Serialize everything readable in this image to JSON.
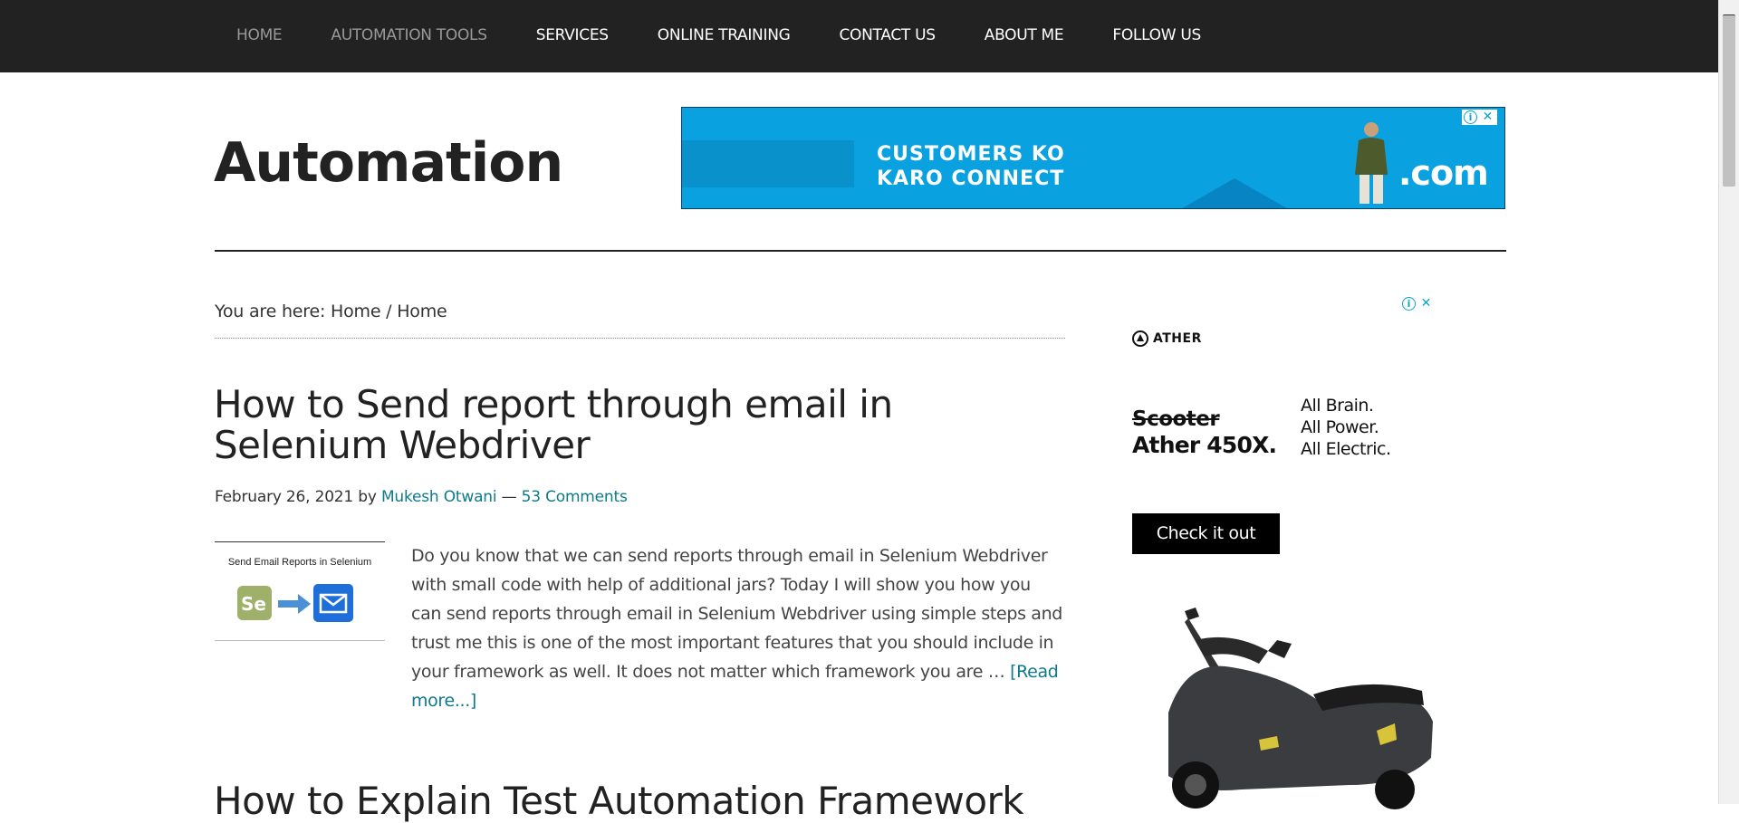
{
  "nav": {
    "items": [
      {
        "label": "HOME"
      },
      {
        "label": "AUTOMATION TOOLS"
      },
      {
        "label": "SERVICES"
      },
      {
        "label": "ONLINE TRAINING"
      },
      {
        "label": "CONTACT US"
      },
      {
        "label": "ABOUT ME"
      },
      {
        "label": "FOLLOW US"
      }
    ]
  },
  "header": {
    "site_title": "Automation"
  },
  "top_ad": {
    "line1": "CUSTOMERS KO",
    "line2": "KARO CONNECT",
    "domain_suffix": ".com",
    "info_icon": "info-icon",
    "close_icon": "close-icon"
  },
  "breadcrumb": {
    "text": "You are here: Home / Home"
  },
  "post": {
    "title": "How to Send report through email in Selenium Webdriver",
    "date": "February 26, 2021",
    "by": "by",
    "author": "Mukesh Otwani",
    "separator": "—",
    "comments": "53 Comments",
    "thumbnail_caption": "Send Email Reports in Selenium",
    "thumbnail_logo": "Se",
    "excerpt": "Do you know that we can send reports through email in Selenium Webdriver with small code with help of additional jars? Today I will show you how you can send reports through email in Selenium Webdriver using simple steps and trust me this is one of the most important features that you should include in your framework as well. It does not matter which framework you are …",
    "read_more": "[Read more...]"
  },
  "next_post": {
    "title": "How to Explain Test Automation Framework"
  },
  "side_ad": {
    "brand": "ATHER",
    "struck_word": "Scooter",
    "model": "Ather 450X.",
    "taglines": [
      "All Brain.",
      "All Power.",
      "All Electric."
    ],
    "cta": "Check it out"
  },
  "colors": {
    "nav_bg": "#222222",
    "link": "#0d7a8c",
    "ad_blue": "#0aa1e0"
  }
}
